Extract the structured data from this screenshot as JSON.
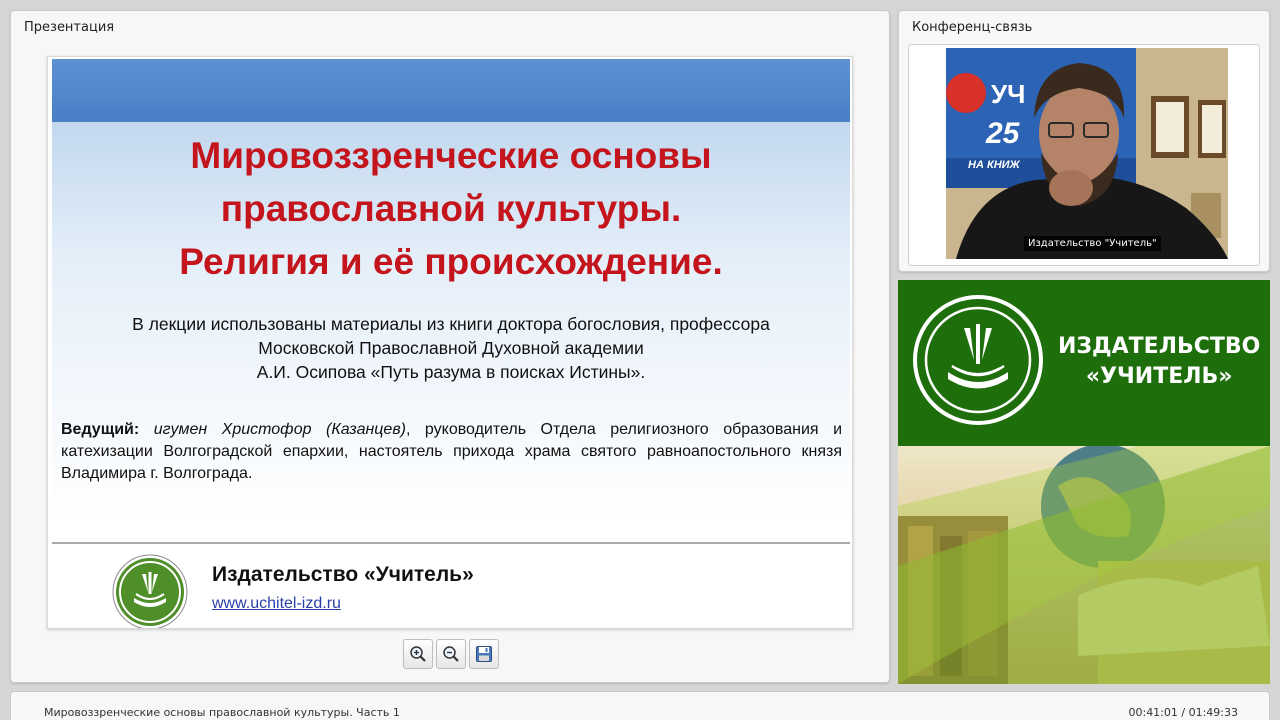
{
  "presentation": {
    "panel_title": "Презентация",
    "slide": {
      "title_lines": [
        "Мировоззренческие основы",
        "православной культуры.",
        "Религия и её происхождение."
      ],
      "subtitle_lines": [
        "В лекции использованы материалы из книги доктора богословия, профессора",
        "Московской Православной Духовной академии",
        "А.И. Осипова «Путь разума в поисках Истины»."
      ],
      "host_label": "Ведущий:",
      "host_name": "игумен Христофор (Казанцев)",
      "host_desc": ", руководитель Отдела религиозного образования и катехизации Волгоградской епархии, настоятель прихода храма святого равноапостольного князя Владимира г. Волгограда.",
      "publisher": "Издательство «Учитель»",
      "url": "www.uchitel-izd.ru"
    },
    "toolbar": {
      "zoom_in_icon": "zoom-in-icon",
      "zoom_out_icon": "zoom-out-icon",
      "save_icon": "floppy-disk-icon"
    }
  },
  "conference": {
    "panel_title": "Конференц-связь",
    "video_label": "Издательство \"Учитель\""
  },
  "banner": {
    "line1": "ИЗДАТЕЛЬСТВО",
    "line2": "«УЧИТЕЛЬ»"
  },
  "status": {
    "title": "Мировоззренческие основы православной культуры. Часть 1",
    "time": "00:41:01 / 01:49:33"
  },
  "colors": {
    "slide_title": "#c4141c",
    "banner_green": "#1e6f0c",
    "link": "#2a3fa8"
  }
}
